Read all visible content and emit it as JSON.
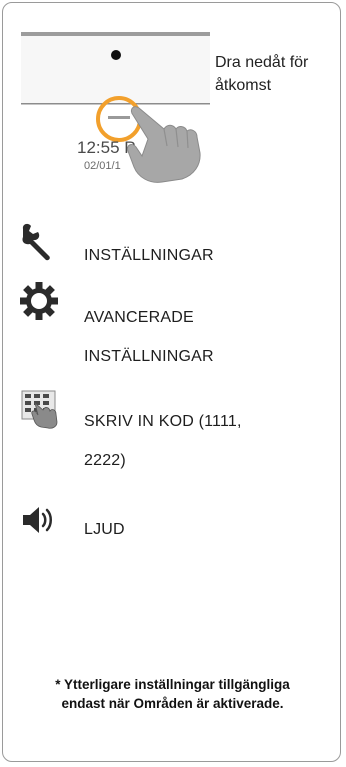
{
  "pulldown": {
    "caption": "Dra nedåt för åtkomst",
    "clock_time": "12:55 P",
    "clock_date": "02/01/1"
  },
  "menu": {
    "items": [
      {
        "label_lines": [
          "INSTÄLLNINGAR"
        ],
        "icon": "wrench-icon"
      },
      {
        "label_lines": [
          "AVANCERADE",
          "INSTÄLLNINGAR"
        ],
        "icon": "gear-icon"
      },
      {
        "label_lines": [
          "SKRIV IN KOD (1111,",
          "2222)"
        ],
        "icon": "keypad-hand-icon"
      },
      {
        "label_lines": [
          "LJUD"
        ],
        "icon": "speaker-icon"
      }
    ]
  },
  "footnote": {
    "line1": "* Ytterligare inställningar tillgängliga",
    "line2": "endast när Områden är aktiverade."
  },
  "colors": {
    "accent_orange": "#f2a02c",
    "icon_dark": "#2b2b2b",
    "frame_border": "#9a9a9a"
  }
}
